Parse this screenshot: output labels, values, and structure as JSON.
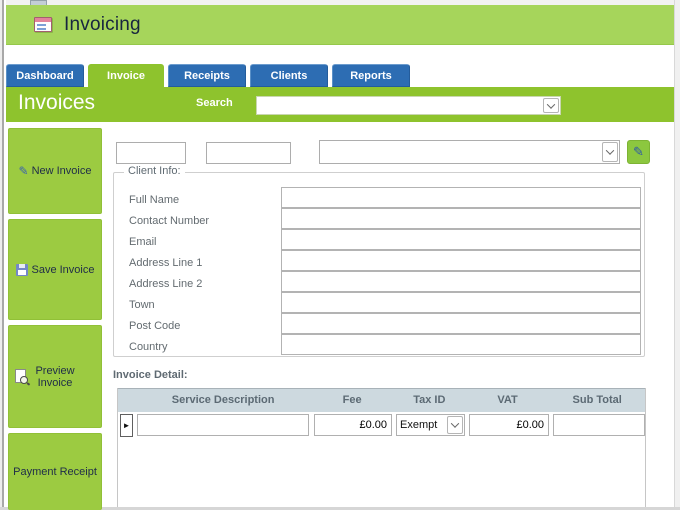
{
  "window": {
    "title": "Invoicing"
  },
  "tabs": {
    "items": [
      {
        "label": "Dashboard",
        "active": false
      },
      {
        "label": "Invoice",
        "active": true
      },
      {
        "label": "Receipts",
        "active": false
      },
      {
        "label": "Clients",
        "active": false
      },
      {
        "label": "Reports",
        "active": false
      }
    ]
  },
  "toolbar": {
    "heading": "Invoices",
    "search_label": "Search",
    "search_value": ""
  },
  "sidebar": {
    "buttons": [
      {
        "label": "New Invoice",
        "icon": "pencil-icon"
      },
      {
        "label": "Save Invoice",
        "icon": "save-icon"
      },
      {
        "label": "Preview Invoice",
        "icon": "print-preview-icon"
      },
      {
        "label": "Payment Receipt",
        "icon": "none"
      }
    ]
  },
  "form": {
    "invoice_number_value": "",
    "invoice_date_value": "",
    "client_select_value": "",
    "client_info": {
      "legend": "Client Info:",
      "fields": [
        {
          "label": "Full Name",
          "value": ""
        },
        {
          "label": "Contact Number",
          "value": ""
        },
        {
          "label": "Email",
          "value": ""
        },
        {
          "label": "Address Line 1",
          "value": ""
        },
        {
          "label": "Address Line 2",
          "value": ""
        },
        {
          "label": "Town",
          "value": ""
        },
        {
          "label": "Post Code",
          "value": ""
        },
        {
          "label": "Country",
          "value": ""
        }
      ]
    },
    "invoice_detail": {
      "label": "Invoice Detail:",
      "columns": [
        "Service Description",
        "Fee",
        "Tax ID",
        "VAT",
        "Sub Total"
      ],
      "row": {
        "service_description": "",
        "fee": "£0.00",
        "tax_id": "Exempt",
        "vat": "£0.00",
        "sub_total": ""
      }
    }
  },
  "colors": {
    "header_green": "#a6d55b",
    "accent_green": "#8ec32d",
    "button_green": "#9ccb41",
    "tab_blue": "#2d6db3",
    "grid_header_bg": "#cdd9df",
    "title_navy": "#17253f"
  }
}
